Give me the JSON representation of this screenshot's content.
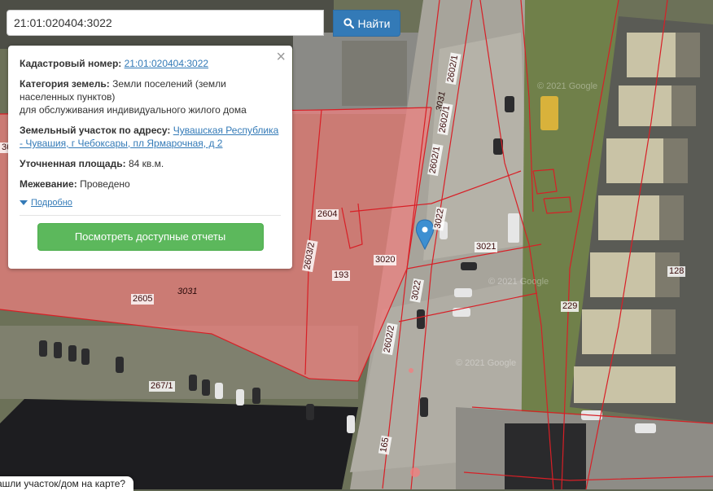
{
  "search": {
    "value": "21:01:020404:3022",
    "button_label": "Найти",
    "button_icon": "search-icon"
  },
  "info": {
    "cadastral_label": "Кадастровый номер:",
    "cadastral_value": "21:01:020404:3022",
    "category_label": "Категория земель:",
    "category_value": "Земли поселений (земли населенных пунктов)",
    "category_purpose": "для обслуживания индивидуального жилого дома",
    "address_label": "Земельный участок по адресу:",
    "address_value": "Чувашская Республика - Чувашия, г Чебоксары, пл Ярмарочная, д 2",
    "area_label": "Уточненная площадь:",
    "area_value": "84 кв.м.",
    "survey_label": "Межевание:",
    "survey_value": "Проведено",
    "details_label": "Подробно",
    "reports_button": "Посмотреть доступные отчеты"
  },
  "bottom_prompt": "ашли участок/дом на карте?",
  "map": {
    "parcel_labels": [
      "2602/1",
      "3031",
      "2602/1",
      "2602/1",
      "2604",
      "3022",
      "3021",
      "2603/2",
      "3020",
      "193",
      "3022",
      "128",
      "2605",
      "3031",
      "229",
      "2602/2",
      "267/1",
      "165",
      "36"
    ],
    "watermark": "© 2021 Google",
    "marker_color": "#3d8fd1",
    "highlight_color": "#f08080",
    "boundary_color": "#d81f26"
  }
}
